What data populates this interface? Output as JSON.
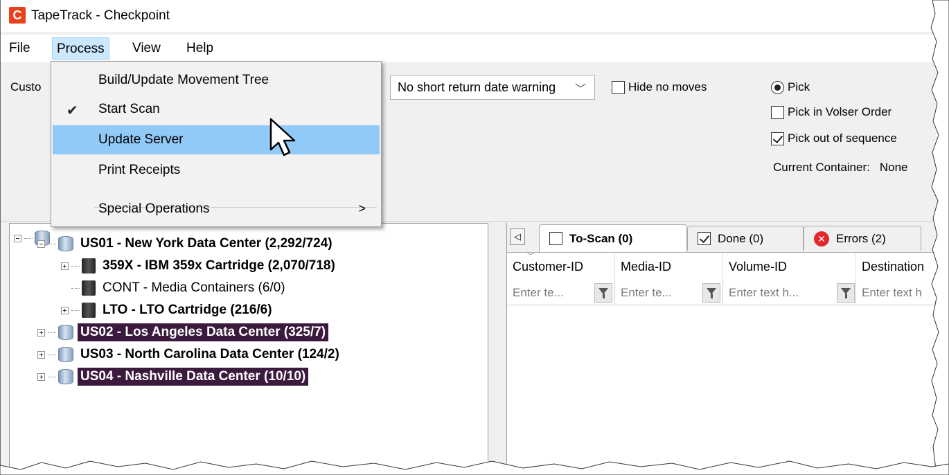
{
  "window": {
    "title": "TapeTrack - Checkpoint",
    "logo_letter": "C"
  },
  "menubar": {
    "items": [
      "File",
      "Process",
      "View",
      "Help"
    ]
  },
  "toolbar": {
    "customer_label": "Custo",
    "warning_combo": "No short return date warning",
    "hide_no_moves_label": "Hide no moves",
    "pick_label": "Pick",
    "pick_volser_label": "Pick in Volser Order",
    "pick_out_of_sequence_label": "Pick out of sequence",
    "current_container_label": "Current Container:",
    "current_container_value": "None"
  },
  "process_menu": {
    "items": [
      {
        "label": "Build/Update Movement Tree"
      },
      {
        "label": "Start Scan",
        "checked": true
      },
      {
        "label": "Update Server",
        "highlighted": true
      },
      {
        "label": "Print Receipts"
      },
      {
        "label": "Special Operations",
        "has_submenu": true
      }
    ]
  },
  "tree": {
    "rows": [
      {
        "label": "US01 - New York Data Center (2,292/724)"
      },
      {
        "label": "359X - IBM 359x Cartridge (2,070/718)"
      },
      {
        "label": "CONT - Media Containers (6/0)"
      },
      {
        "label": "LTO - LTO Cartridge (216/6)"
      },
      {
        "label": "US02 - Los Angeles Data Center (325/7)"
      },
      {
        "label": "US03 - North Carolina Data Center (124/2)"
      },
      {
        "label": "US04 - Nashville Data Center (10/10)"
      }
    ]
  },
  "tabs": [
    {
      "label": "To-Scan (0)"
    },
    {
      "label": "Done (0)"
    },
    {
      "label": "Errors (2)"
    }
  ],
  "grid": {
    "columns": [
      {
        "header": "Customer-ID",
        "filter_placeholder": "Enter te..."
      },
      {
        "header": "Media-ID",
        "filter_placeholder": "Enter te..."
      },
      {
        "header": "Volume-ID",
        "filter_placeholder": "Enter text h..."
      },
      {
        "header": "Destination",
        "filter_placeholder": "Enter text h"
      }
    ]
  },
  "colors": {
    "highlight": "#91c9f7",
    "selection": "#3b1a3e",
    "error": "#e3272c",
    "logo": "#e8421c"
  }
}
